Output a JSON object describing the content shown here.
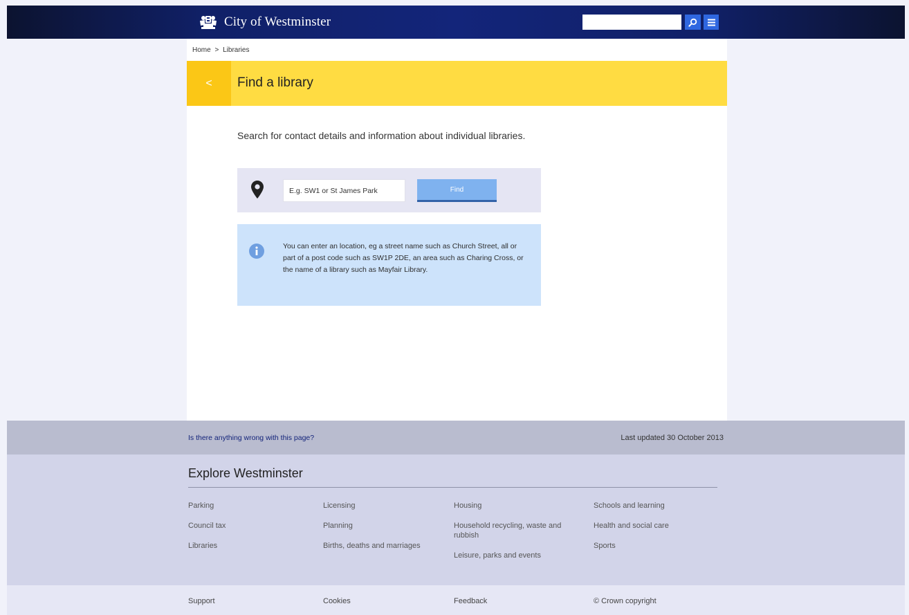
{
  "header": {
    "site_name": "City of Westminster",
    "search_placeholder": "",
    "brand_color": "#13257a",
    "button_color": "#2f67e0",
    "icons": [
      "crest-logo",
      "search-icon",
      "menu-icon"
    ]
  },
  "breadcrumb": {
    "home": "Home",
    "separator": ">",
    "current": "Libraries"
  },
  "title_bar": {
    "back_label": "<",
    "title": "Find a library",
    "accent_color": "#ffdc42"
  },
  "main": {
    "intro": "Search for contact details and information about individual libraries.",
    "search": {
      "placeholder": "E.g. SW1 or St James Park",
      "find_label": "Find"
    },
    "info": "You can enter an location, eg a street name such as Church Street, all or part of a post code such as SW1P 2DE, an area such as Charing Cross, or the name of a library such as Mayfair Library."
  },
  "feedback": {
    "wrong_link": "Is there anything wrong with this page?",
    "last_updated": "Last updated  30 October 2013"
  },
  "explore": {
    "title": "Explore Westminster",
    "columns": [
      [
        "Parking",
        "Council tax",
        "Libraries"
      ],
      [
        "Licensing",
        "Planning",
        "Births, deaths and marriages"
      ],
      [
        "Housing",
        "Household recycling, waste and rubbish",
        "Leisure, parks and events"
      ],
      [
        "Schools and learning",
        "Health and social care",
        "Sports"
      ]
    ]
  },
  "footer": {
    "links": [
      "Support",
      "Cookies",
      "Feedback",
      "© Crown copyright"
    ]
  }
}
